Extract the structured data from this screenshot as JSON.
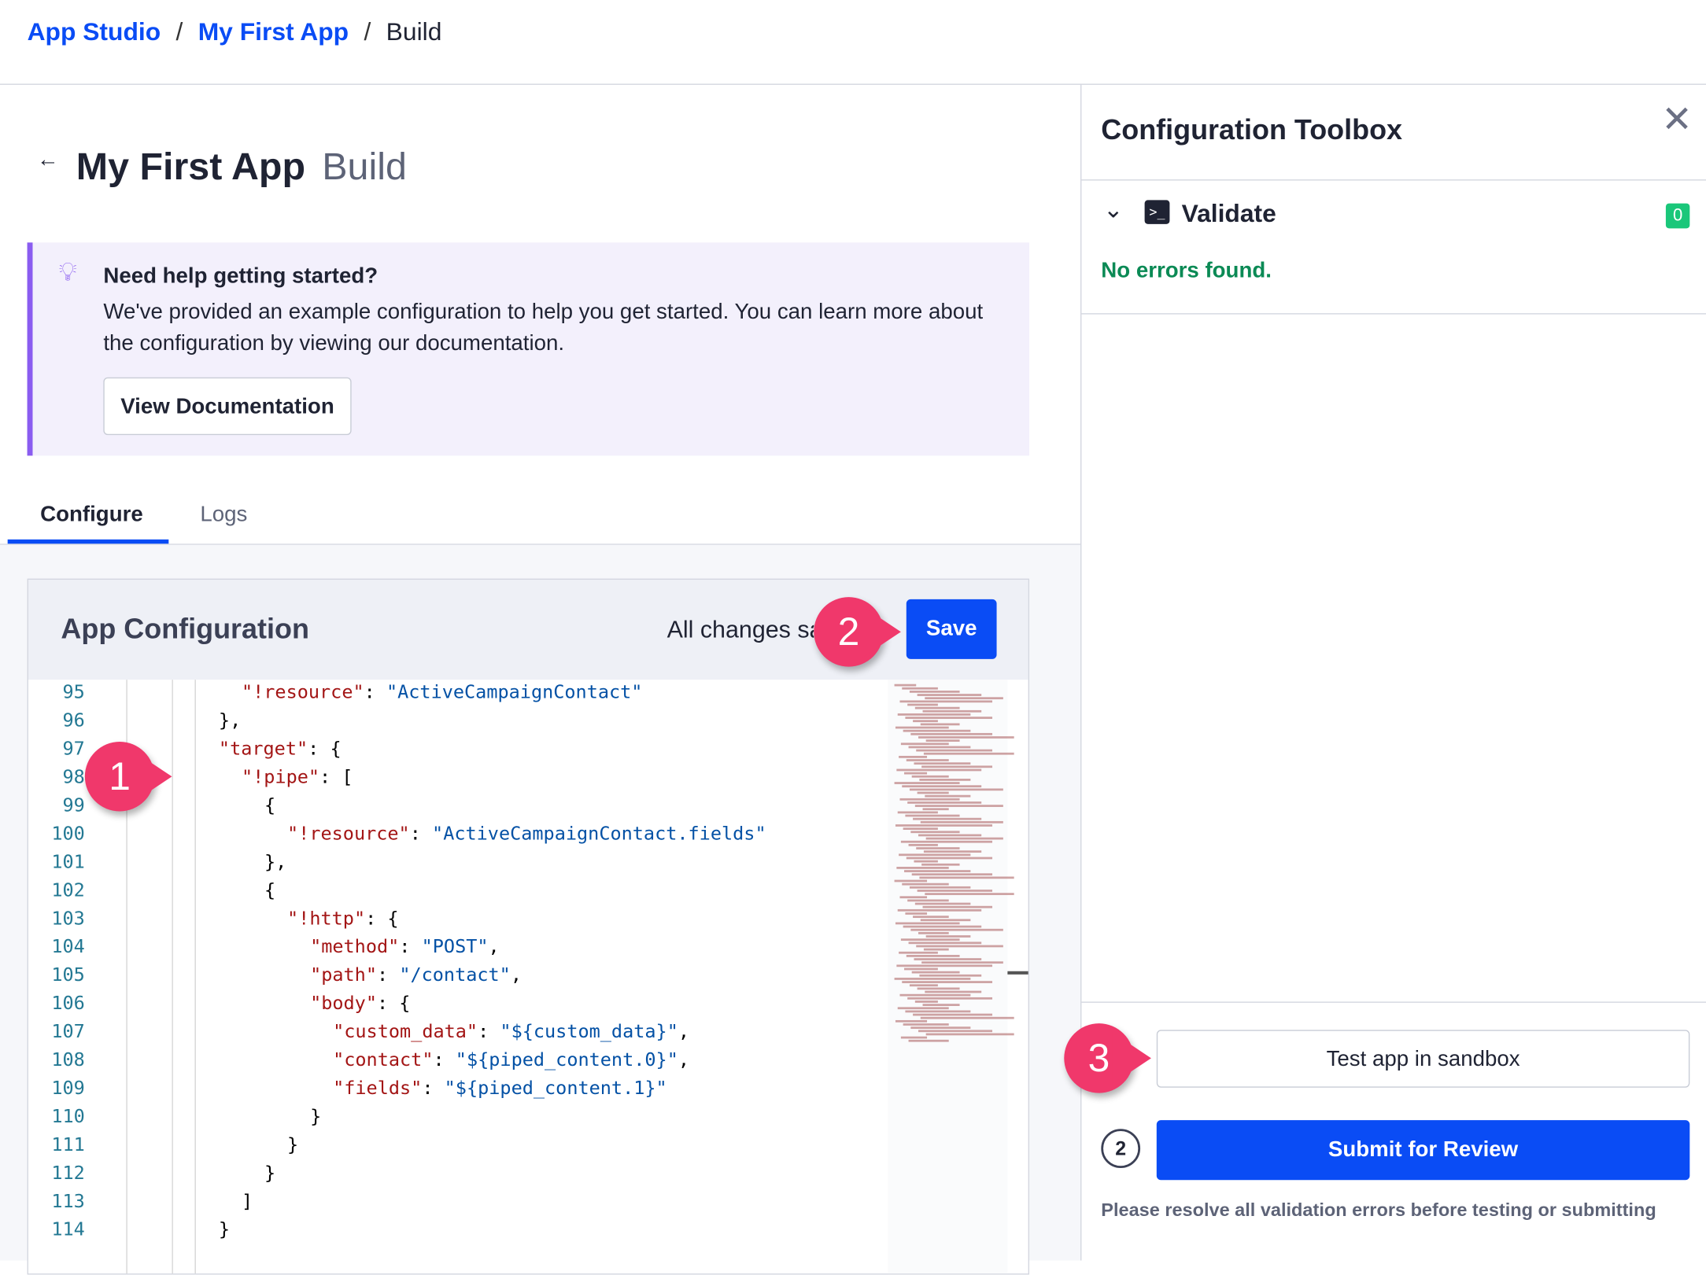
{
  "breadcrumb": [
    "App Studio",
    "My First App",
    "Build"
  ],
  "header": {
    "title": "My First App",
    "subtitle": "Build",
    "back_icon": "arrow-left-icon"
  },
  "help": {
    "heading": "Need help getting started?",
    "text": "We've provided an example configuration to help you get started. You can learn more about the configuration by viewing our documentation.",
    "button": "View Documentation",
    "icon": "lightbulb-icon"
  },
  "tabs": [
    {
      "label": "Configure",
      "active": true
    },
    {
      "label": "Logs",
      "active": false
    }
  ],
  "editor": {
    "title": "App Configuration",
    "status": "All changes saved",
    "save": "Save",
    "lines": [
      {
        "n": "95",
        "i": 3,
        "t": [
          [
            "k",
            "\"!resource\""
          ],
          [
            "pn",
            ": "
          ],
          [
            "v",
            "\"ActiveCampaignContact\""
          ]
        ]
      },
      {
        "n": "96",
        "i": 2,
        "t": [
          [
            "pn",
            "},"
          ]
        ]
      },
      {
        "n": "97",
        "i": 2,
        "t": [
          [
            "k",
            "\"target\""
          ],
          [
            "pn",
            ": {"
          ]
        ]
      },
      {
        "n": "98",
        "i": 3,
        "t": [
          [
            "k",
            "\"!pipe\""
          ],
          [
            "pn",
            ": ["
          ]
        ]
      },
      {
        "n": "99",
        "i": 4,
        "t": [
          [
            "pn",
            "{"
          ]
        ]
      },
      {
        "n": "100",
        "i": 5,
        "t": [
          [
            "k",
            "\"!resource\""
          ],
          [
            "pn",
            ": "
          ],
          [
            "v",
            "\"ActiveCampaignContact.fields\""
          ]
        ]
      },
      {
        "n": "101",
        "i": 4,
        "t": [
          [
            "pn",
            "},"
          ]
        ]
      },
      {
        "n": "102",
        "i": 4,
        "t": [
          [
            "pn",
            "{"
          ]
        ]
      },
      {
        "n": "103",
        "i": 5,
        "t": [
          [
            "k",
            "\"!http\""
          ],
          [
            "pn",
            ": {"
          ]
        ]
      },
      {
        "n": "104",
        "i": 6,
        "t": [
          [
            "k",
            "\"method\""
          ],
          [
            "pn",
            ": "
          ],
          [
            "v",
            "\"POST\""
          ],
          [
            "pn",
            ","
          ]
        ]
      },
      {
        "n": "105",
        "i": 6,
        "t": [
          [
            "k",
            "\"path\""
          ],
          [
            "pn",
            ": "
          ],
          [
            "v",
            "\"/contact\""
          ],
          [
            "pn",
            ","
          ]
        ]
      },
      {
        "n": "106",
        "i": 6,
        "t": [
          [
            "k",
            "\"body\""
          ],
          [
            "pn",
            ": {"
          ]
        ]
      },
      {
        "n": "107",
        "i": 7,
        "t": [
          [
            "k",
            "\"custom_data\""
          ],
          [
            "pn",
            ": "
          ],
          [
            "v",
            "\"${custom_data}\""
          ],
          [
            "pn",
            ","
          ]
        ]
      },
      {
        "n": "108",
        "i": 7,
        "t": [
          [
            "k",
            "\"contact\""
          ],
          [
            "pn",
            ": "
          ],
          [
            "v",
            "\"${piped_content.0}\""
          ],
          [
            "pn",
            ","
          ]
        ]
      },
      {
        "n": "109",
        "i": 7,
        "t": [
          [
            "k",
            "\"fields\""
          ],
          [
            "pn",
            ": "
          ],
          [
            "v",
            "\"${piped_content.1}\""
          ]
        ]
      },
      {
        "n": "110",
        "i": 6,
        "t": [
          [
            "pn",
            "}"
          ]
        ]
      },
      {
        "n": "111",
        "i": 5,
        "t": [
          [
            "pn",
            "}"
          ]
        ]
      },
      {
        "n": "112",
        "i": 4,
        "t": [
          [
            "pn",
            "}"
          ]
        ]
      },
      {
        "n": "113",
        "i": 3,
        "t": [
          [
            "pn",
            "]"
          ]
        ]
      },
      {
        "n": "114",
        "i": 2,
        "t": [
          [
            "pn",
            "}"
          ]
        ]
      }
    ]
  },
  "toolbox": {
    "title": "Configuration Toolbox",
    "close_icon": "close-icon",
    "section": "Validate",
    "error_count": "0",
    "message": "No errors found.",
    "sandbox": "Test app in sandbox",
    "step": "2",
    "submit": "Submit for Review",
    "note": "Please resolve all validation errors before testing or submitting"
  },
  "annotations": [
    "1",
    "2",
    "3"
  ],
  "colors": {
    "accent": "#0a4cf5",
    "success": "#0b8a55",
    "annotation": "#f0386b",
    "help_border": "#8a5cf0"
  }
}
